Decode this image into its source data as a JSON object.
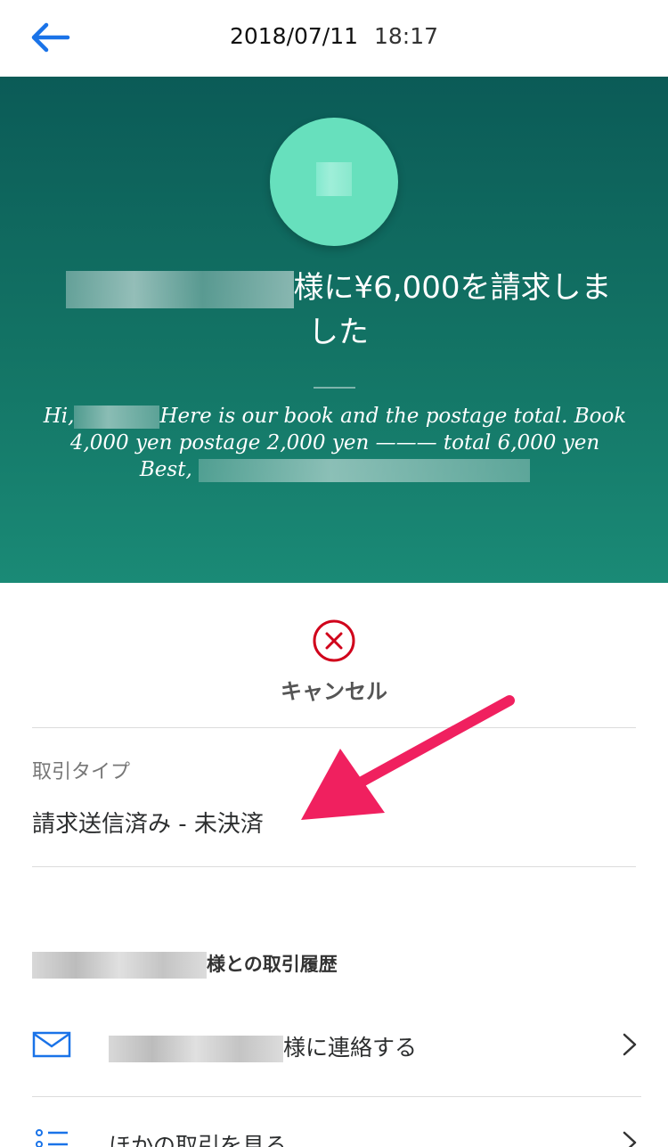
{
  "header": {
    "date": "2018/07/11",
    "time": "18:17"
  },
  "hero": {
    "headline_line1": "様に¥6,000を請求しま",
    "headline_line2": "した",
    "message_hi": "Hi,",
    "message_part1": "Here is our book and the postage total.  Book",
    "message_line2": "4,000 yen postage 2,000 yen ——— total 6,000 yen",
    "message_best": "Best,"
  },
  "cancel": {
    "label": "キャンセル"
  },
  "transaction": {
    "type_label": "取引タイプ",
    "type_value": "請求送信済み - 未決済"
  },
  "history": {
    "title_suffix": "様との取引履歴",
    "contact_suffix": "様に連絡する",
    "other_label": "ほかの取引を見る"
  },
  "colors": {
    "accent": "#1a73e8",
    "hero_top": "#0b5b57",
    "hero_bottom": "#1a8a76",
    "avatar": "#67e0bd",
    "cancel_red": "#d0021b",
    "annotation_arrow": "#f0205f"
  }
}
